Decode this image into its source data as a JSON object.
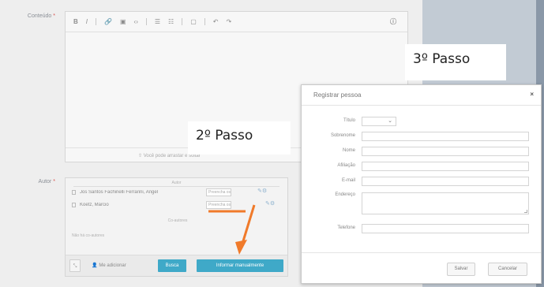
{
  "colors": {
    "accent_blue": "#3fa9c8",
    "required_red": "#d9534f",
    "annotation_orange": "#f07a2a",
    "right_panel": "#c2cbd4"
  },
  "form": {
    "content_label": "Conteúdo",
    "author_label": "Autor",
    "required_mark": "*"
  },
  "editor": {
    "toolbar": {
      "bold": "B",
      "italic": "I",
      "link": "🔗",
      "image": "▣",
      "code": "‹›",
      "bullet_list": "☰",
      "number_list": "☷",
      "block": "▢",
      "undo": "↶",
      "redo": "↷",
      "info": "ⓘ"
    },
    "hint": "⇧ Você pode arrastar e soltar"
  },
  "authors": {
    "section_title": "Autor",
    "rows": [
      {
        "name": "Jos Santos Fachinelli Ferrarini, Angel",
        "input": "Preencha os",
        "selected": "Preencha os"
      },
      {
        "name": "Koetz, Marcio",
        "input": "Preencha os"
      }
    ],
    "sub_title": "Co-autores",
    "empty_note": "Não há co-autores",
    "buttons": {
      "expand": "⤡",
      "add_me": "Me adicionar",
      "search": "Busca",
      "manual": "Informar manualmente"
    }
  },
  "dialog": {
    "title": "Registrar pessoa",
    "close": "×",
    "fields": [
      {
        "label": "Título",
        "type": "select",
        "value": "⌄"
      },
      {
        "label": "Sobrenome",
        "type": "input",
        "value": ""
      },
      {
        "label": "Nome",
        "type": "input",
        "value": ""
      },
      {
        "label": "Afiliação",
        "type": "input",
        "value": ""
      },
      {
        "label": "E-mail",
        "type": "input",
        "value": ""
      },
      {
        "label": "Endereço",
        "type": "textarea",
        "value": ""
      },
      {
        "label": "Telefone",
        "type": "input",
        "value": ""
      }
    ],
    "save": "Salvar",
    "cancel": "Cancelar"
  },
  "annotations": {
    "step2": "2º Passo",
    "step3": "3º Passo"
  }
}
